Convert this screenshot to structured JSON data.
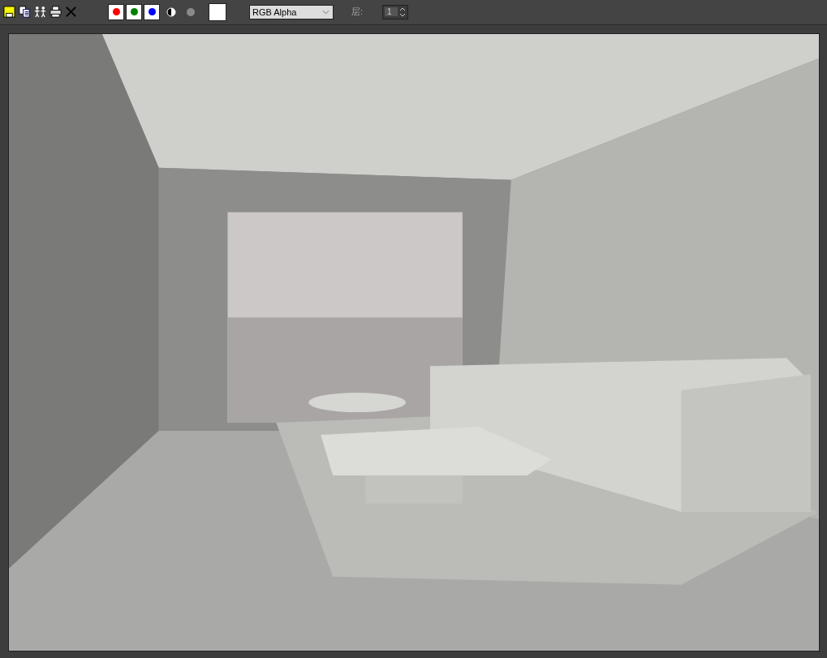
{
  "toolbar": {
    "channels": [
      {
        "color": "#ff0000",
        "on": true
      },
      {
        "color": "#008000",
        "on": true
      },
      {
        "color": "#0000ff",
        "on": true
      }
    ],
    "channel_select": {
      "value": "RGB Alpha"
    },
    "layer": {
      "label": "层:",
      "value": "1"
    }
  }
}
